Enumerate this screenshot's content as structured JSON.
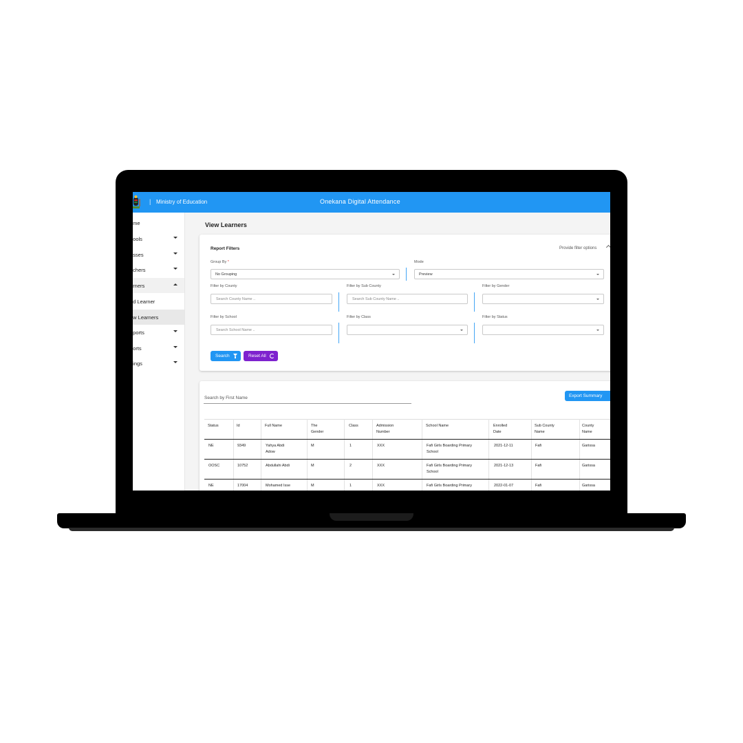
{
  "topbar": {
    "separator": "|",
    "ministry": "Ministry of Education",
    "app_title": "Onekana Digital Attendance",
    "color": "#2196f3"
  },
  "sidebar": {
    "items": [
      {
        "label": "Home",
        "shown": "ome"
      },
      {
        "label": "Schools",
        "shown": "hools"
      },
      {
        "label": "Classes",
        "shown": "asses"
      },
      {
        "label": "Teachers",
        "shown": "achers"
      },
      {
        "label": "Learners",
        "shown": "arners"
      },
      {
        "label": "Add Learner",
        "shown": "dd Learner"
      },
      {
        "label": "View Learners",
        "shown": "ew Learners"
      },
      {
        "label": "Reports",
        "shown": "eports"
      },
      {
        "label": "Reports",
        "shown": "ports"
      },
      {
        "label": "Settings",
        "shown": "ttings"
      }
    ]
  },
  "page": {
    "title": "View Learners"
  },
  "filters": {
    "title": "Report Filters",
    "options_label": "Provide filter options",
    "group_by_label": "Group By",
    "required_mark": "*",
    "group_by_value": "No Grouping",
    "mode_label": "Mode",
    "mode_value": "Preview",
    "county_label": "Filter by County",
    "county_placeholder": "Search County Name ..",
    "subcounty_label": "Filter by Sub County",
    "subcounty_placeholder": "Search Sub County Name ..",
    "gender_label": "Filter by Gender",
    "school_label": "Filter by School",
    "school_placeholder": "Search School Name ..",
    "class_label": "Filter by Class",
    "status_label": "Filter by Status",
    "search_button": "Search",
    "reset_button": "Reset All"
  },
  "table_section": {
    "search_placeholder": "Search by First Name",
    "export_button": "Export Summary",
    "columns": [
      {
        "line1": "",
        "line2": "Status"
      },
      {
        "line1": "",
        "line2": "Id"
      },
      {
        "line1": "",
        "line2": "Full Name"
      },
      {
        "line1": "The",
        "line2": "Gender"
      },
      {
        "line1": "",
        "line2": "Class"
      },
      {
        "line1": "Admission",
        "line2": "Number"
      },
      {
        "line1": "",
        "line2": "School Name"
      },
      {
        "line1": "Enrolled",
        "line2": "Date"
      },
      {
        "line1": "Sub County",
        "line2": "Name"
      },
      {
        "line1": "County",
        "line2": "Name"
      }
    ],
    "rows": [
      {
        "status": "NE",
        "id": "9349",
        "name1": "Yahya Abdi",
        "name2": "Adow",
        "gender": "M",
        "class": "1",
        "admission": "XXX",
        "school1": "Fafi Girls Boarding Primary",
        "school2": "School",
        "enrolled": "2021-12-11",
        "subcounty": "Fafi",
        "county": "Garissa"
      },
      {
        "status": "OOSC",
        "id": "10752",
        "name1": "Abdullahi Abdi",
        "name2": "",
        "gender": "M",
        "class": "2",
        "admission": "XXX",
        "school1": "Fafi Girls Boarding Primary",
        "school2": "School",
        "enrolled": "2021-12-13",
        "subcounty": "Fafi",
        "county": "Garissa"
      },
      {
        "status": "NE",
        "id": "17004",
        "name1": "Mohamed Isse",
        "name2": "",
        "gender": "M",
        "class": "1",
        "admission": "XXX",
        "school1": "Fafi Girls Boarding Primary",
        "school2": "",
        "enrolled": "2022-01-07",
        "subcounty": "Fafi",
        "county": "Garissa"
      }
    ]
  }
}
